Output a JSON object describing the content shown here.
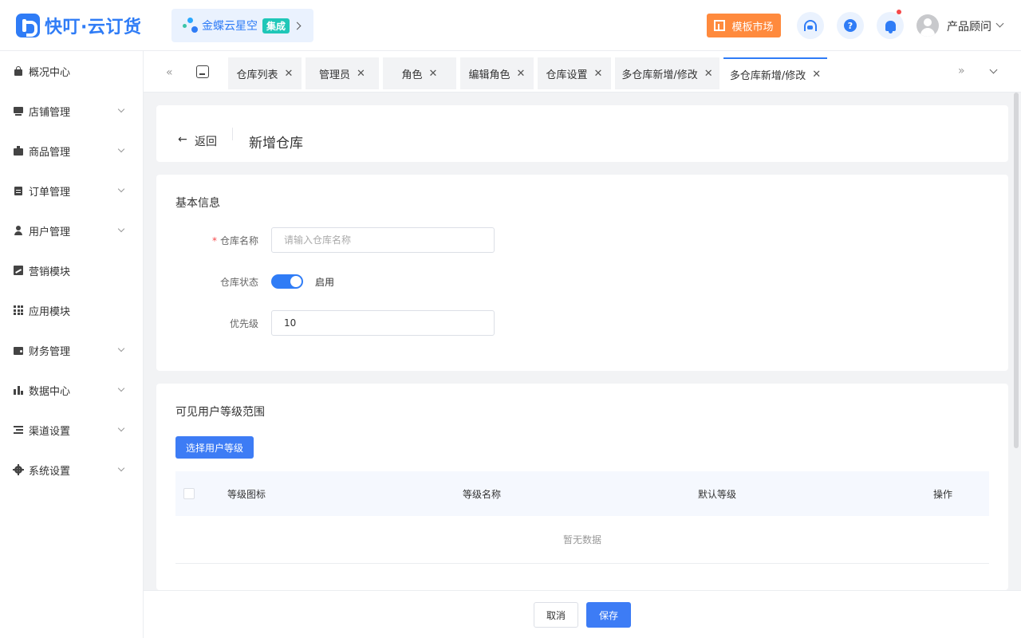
{
  "header": {
    "logo_text": "快叮·云订货",
    "kingdee_label": "金蝶云星空",
    "kingdee_badge": "集成",
    "template_market": "模板市场",
    "help_glyph": "?",
    "user_name": "产品顾问"
  },
  "sidebar": {
    "items": [
      {
        "label": "概况中心",
        "icon": "home-lock-icon",
        "expandable": false
      },
      {
        "label": "店铺管理",
        "icon": "shop-icon",
        "expandable": true
      },
      {
        "label": "商品管理",
        "icon": "briefcase-icon",
        "expandable": true
      },
      {
        "label": "订单管理",
        "icon": "clipboard-icon",
        "expandable": true
      },
      {
        "label": "用户管理",
        "icon": "user-icon",
        "expandable": true
      },
      {
        "label": "营销模块",
        "icon": "trend-chart-icon",
        "expandable": false
      },
      {
        "label": "应用模块",
        "icon": "grid-icon",
        "expandable": false
      },
      {
        "label": "财务管理",
        "icon": "wallet-icon",
        "expandable": true
      },
      {
        "label": "数据中心",
        "icon": "bar-chart-icon",
        "expandable": true
      },
      {
        "label": "渠道设置",
        "icon": "list-settings-icon",
        "expandable": true
      },
      {
        "label": "系统设置",
        "icon": "gear-icon",
        "expandable": true
      }
    ]
  },
  "tabs": {
    "prev": "«",
    "next": "»",
    "items": [
      {
        "label": "仓库列表",
        "active": false
      },
      {
        "label": "管理员",
        "active": false
      },
      {
        "label": "角色",
        "active": false
      },
      {
        "label": "编辑角色",
        "active": false
      },
      {
        "label": "仓库设置",
        "active": false
      },
      {
        "label": "多仓库新增/修改",
        "active": false
      },
      {
        "label": "多仓库新增/修改",
        "active": true
      }
    ],
    "close_glyph": "✕"
  },
  "page": {
    "back_arrow": "←",
    "back_label": "返回",
    "title": "新增仓库"
  },
  "basic_info": {
    "section_title": "基本信息",
    "name_required": "*",
    "name_label": "仓库名称",
    "name_placeholder": "请输入仓库名称",
    "name_value": "",
    "status_label": "仓库状态",
    "status_enabled": true,
    "status_text": "启用",
    "priority_label": "优先级",
    "priority_value": "10"
  },
  "user_level": {
    "section_title": "可见用户等级范围",
    "select_button": "选择用户等级",
    "columns": [
      "等级图标",
      "等级名称",
      "默认等级",
      "操作"
    ],
    "empty_text": "暂无数据"
  },
  "footer": {
    "cancel": "取消",
    "save": "保存"
  },
  "colors": {
    "primary": "#2f7cf6",
    "template_orange": "#ff8a3d",
    "badge_teal": "#1fc7b8",
    "required_red": "#f5484a"
  }
}
